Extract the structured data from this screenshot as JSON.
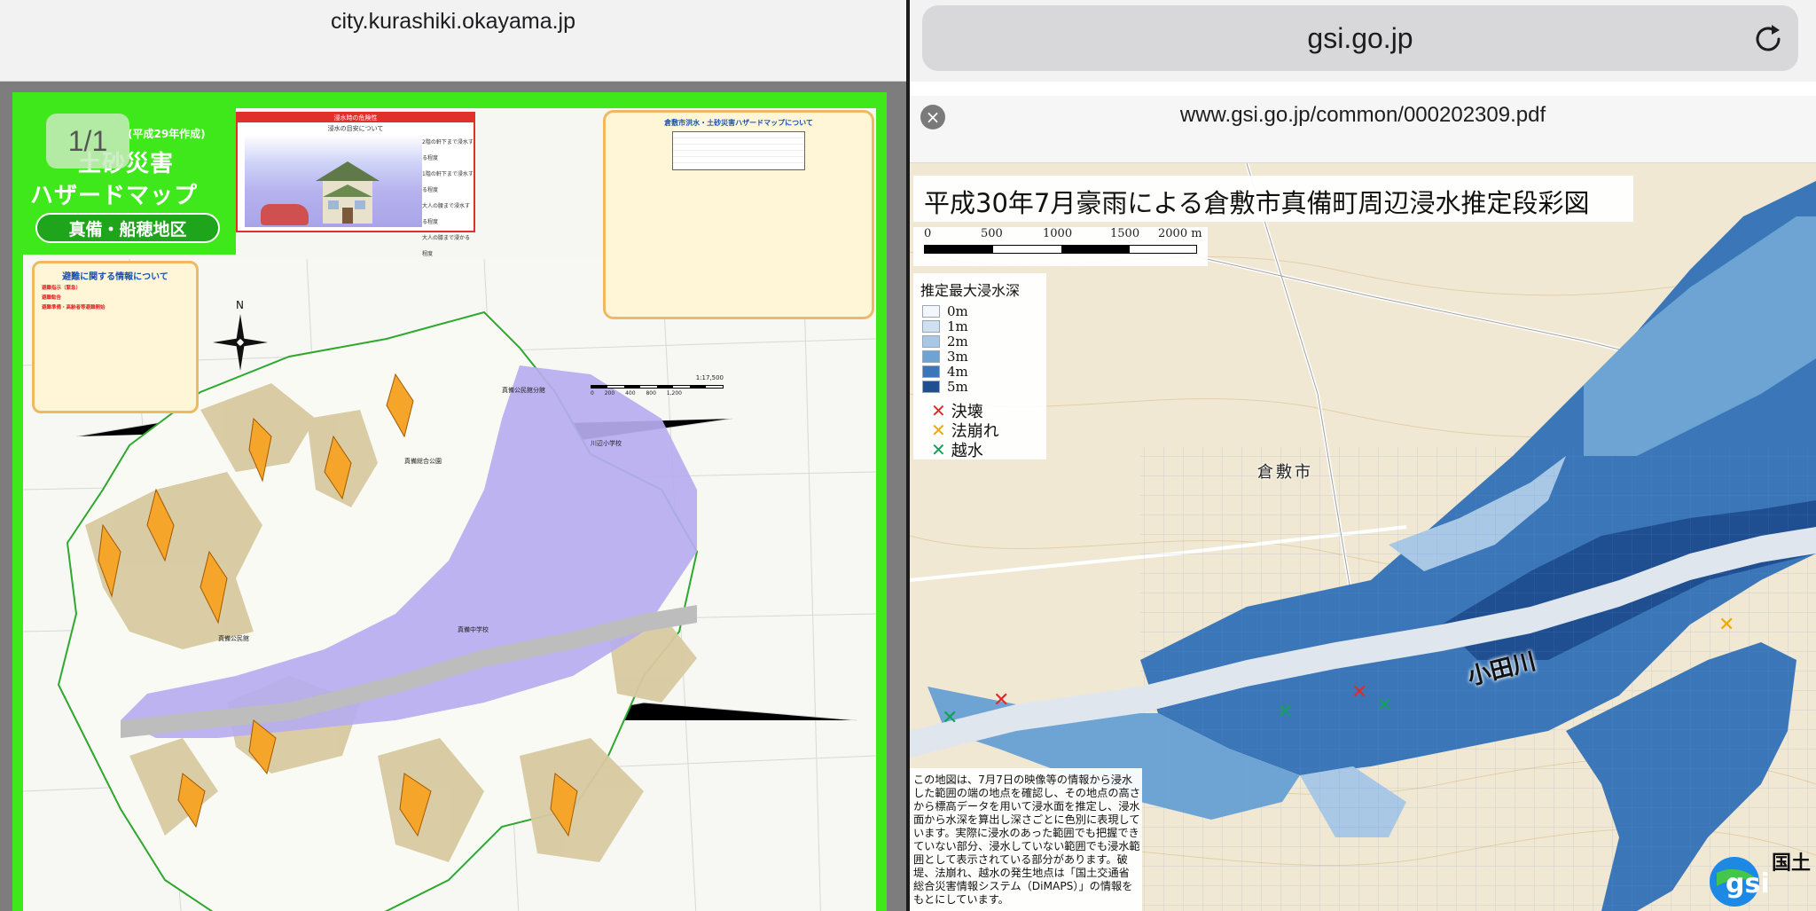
{
  "left_browser": {
    "url": "city.kurashiki.okayama.jp",
    "page_indicator": "1/1"
  },
  "hazard_map": {
    "year_note": "(平成29年作成)",
    "title_line1": "土砂災害",
    "title_line2": "ハザードマップ",
    "area_name": "真備・船穂地区",
    "depth_panel_title": "浸水時の危険性",
    "depth_panel_subtitle": "浸水の目安について",
    "depth_levels": [
      "2階の軒下まで浸水する程度",
      "1階の軒下まで浸水する程度",
      "大人の腰まで浸水する程度",
      "大人の膝まで浸かる程度"
    ],
    "info_panel_title": "倉敷市洪水・土砂災害ハザードマップについて",
    "evac_panel_title": "避難に関する情報について",
    "evac_items": [
      "避難指示（緊急）",
      "避難勧告",
      "避難準備・高齢者等避難開始"
    ],
    "north_label": "N",
    "scale_text": "1:17,500",
    "scale_ticks": "0 200 400 800 1,200"
  },
  "right_browser": {
    "url": "gsi.go.jp",
    "pdf_filename": "www.gsi.go.jp/common/000202309.pdf"
  },
  "flood_map": {
    "title": "平成30年7月豪雨による倉敷市真備町周辺浸水推定段彩図",
    "scale_ticks": [
      "0",
      "500",
      "1000",
      "1500",
      "2000 m"
    ],
    "legend_title": "推定最大浸水深",
    "depth_legend": [
      {
        "label": "0m",
        "color": "#f3f6fb"
      },
      {
        "label": "1m",
        "color": "#cfe0f1"
      },
      {
        "label": "2m",
        "color": "#a9c8e6"
      },
      {
        "label": "3m",
        "color": "#6ea4d4"
      },
      {
        "label": "4m",
        "color": "#3b77b8"
      },
      {
        "label": "5m",
        "color": "#1f4f91"
      }
    ],
    "marks": [
      {
        "symbol": "✕",
        "label": "決壊",
        "color": "#e02a2a"
      },
      {
        "symbol": "✕",
        "label": "法崩れ",
        "color": "#f0a800"
      },
      {
        "symbol": "✕",
        "label": "越水",
        "color": "#14a05a"
      }
    ],
    "river_label": "小田川",
    "city_label": "倉敷市",
    "note": "この地図は、7月7日の映像等の情報から浸水した範囲の端の地点を確認し、その地点の高さから標高データを用いて浸水面を推定し、浸水面から水深を算出し深さごとに色別に表現しています。実際に浸水のあった範囲でも把握できていない部分、浸水していない範囲でも浸水範囲として表示されている部分があります。破堤、法崩れ、越水の発生地点は「国土交通省総合災害情報システム（DiMAPS）」の情報をもとにしています。",
    "logo_text": "国土"
  }
}
